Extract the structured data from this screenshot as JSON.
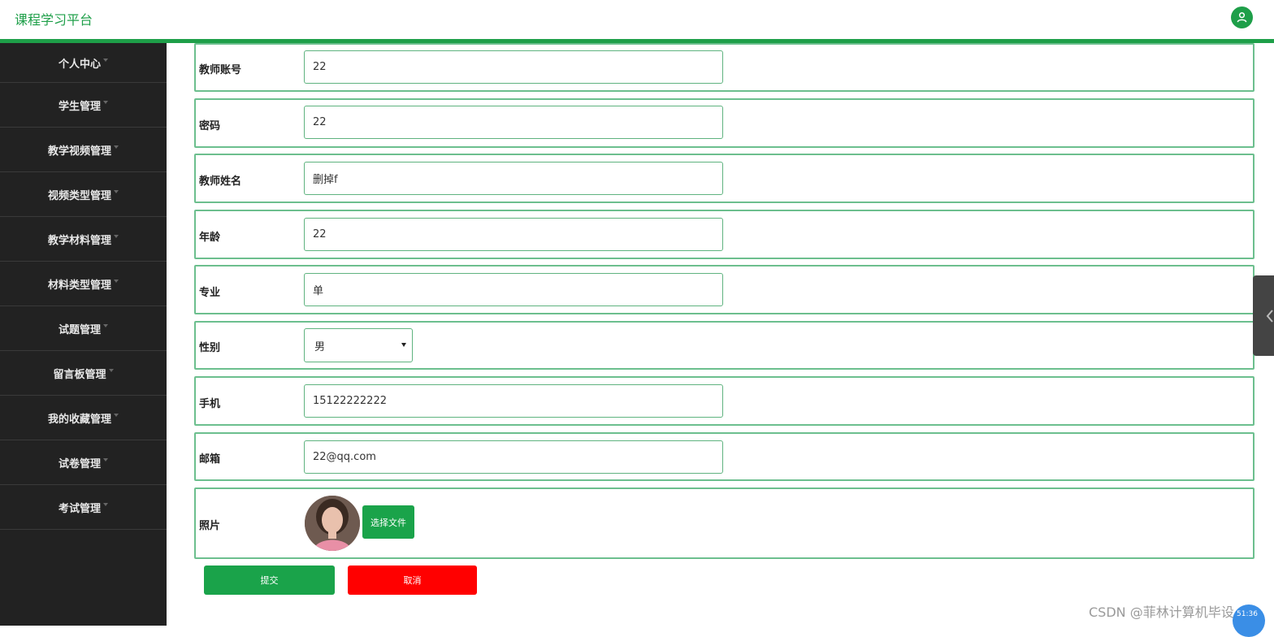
{
  "header": {
    "app_title": "课程学习平台",
    "user_icon": "user-icon"
  },
  "sidebar": {
    "items": [
      {
        "label": "个人中心"
      },
      {
        "label": "学生管理"
      },
      {
        "label": "教学视频管理"
      },
      {
        "label": "视频类型管理"
      },
      {
        "label": "教学材料管理"
      },
      {
        "label": "材料类型管理"
      },
      {
        "label": "试题管理"
      },
      {
        "label": "留言板管理"
      },
      {
        "label": "我的收藏管理"
      },
      {
        "label": "试卷管理"
      },
      {
        "label": "考试管理"
      }
    ]
  },
  "form": {
    "account": {
      "label": "教师账号",
      "value": "22"
    },
    "password": {
      "label": "密码",
      "value": "22"
    },
    "name": {
      "label": "教师姓名",
      "value": "删掉f"
    },
    "age": {
      "label": "年龄",
      "value": "22"
    },
    "major": {
      "label": "专业",
      "value": "单"
    },
    "gender": {
      "label": "性别",
      "value": "男"
    },
    "phone": {
      "label": "手机",
      "value": "15122222222"
    },
    "email": {
      "label": "邮箱",
      "value": "22@qq.com"
    },
    "photo": {
      "label": "照片",
      "button": "选择文件"
    }
  },
  "actions": {
    "submit": "提交",
    "cancel": "取消"
  },
  "watermark": "CSDN @菲林计算机毕设",
  "badge_text": "51:36",
  "colors": {
    "primary": "#1e9f49",
    "danger": "#ff0000",
    "sidebar_bg": "#222222"
  }
}
